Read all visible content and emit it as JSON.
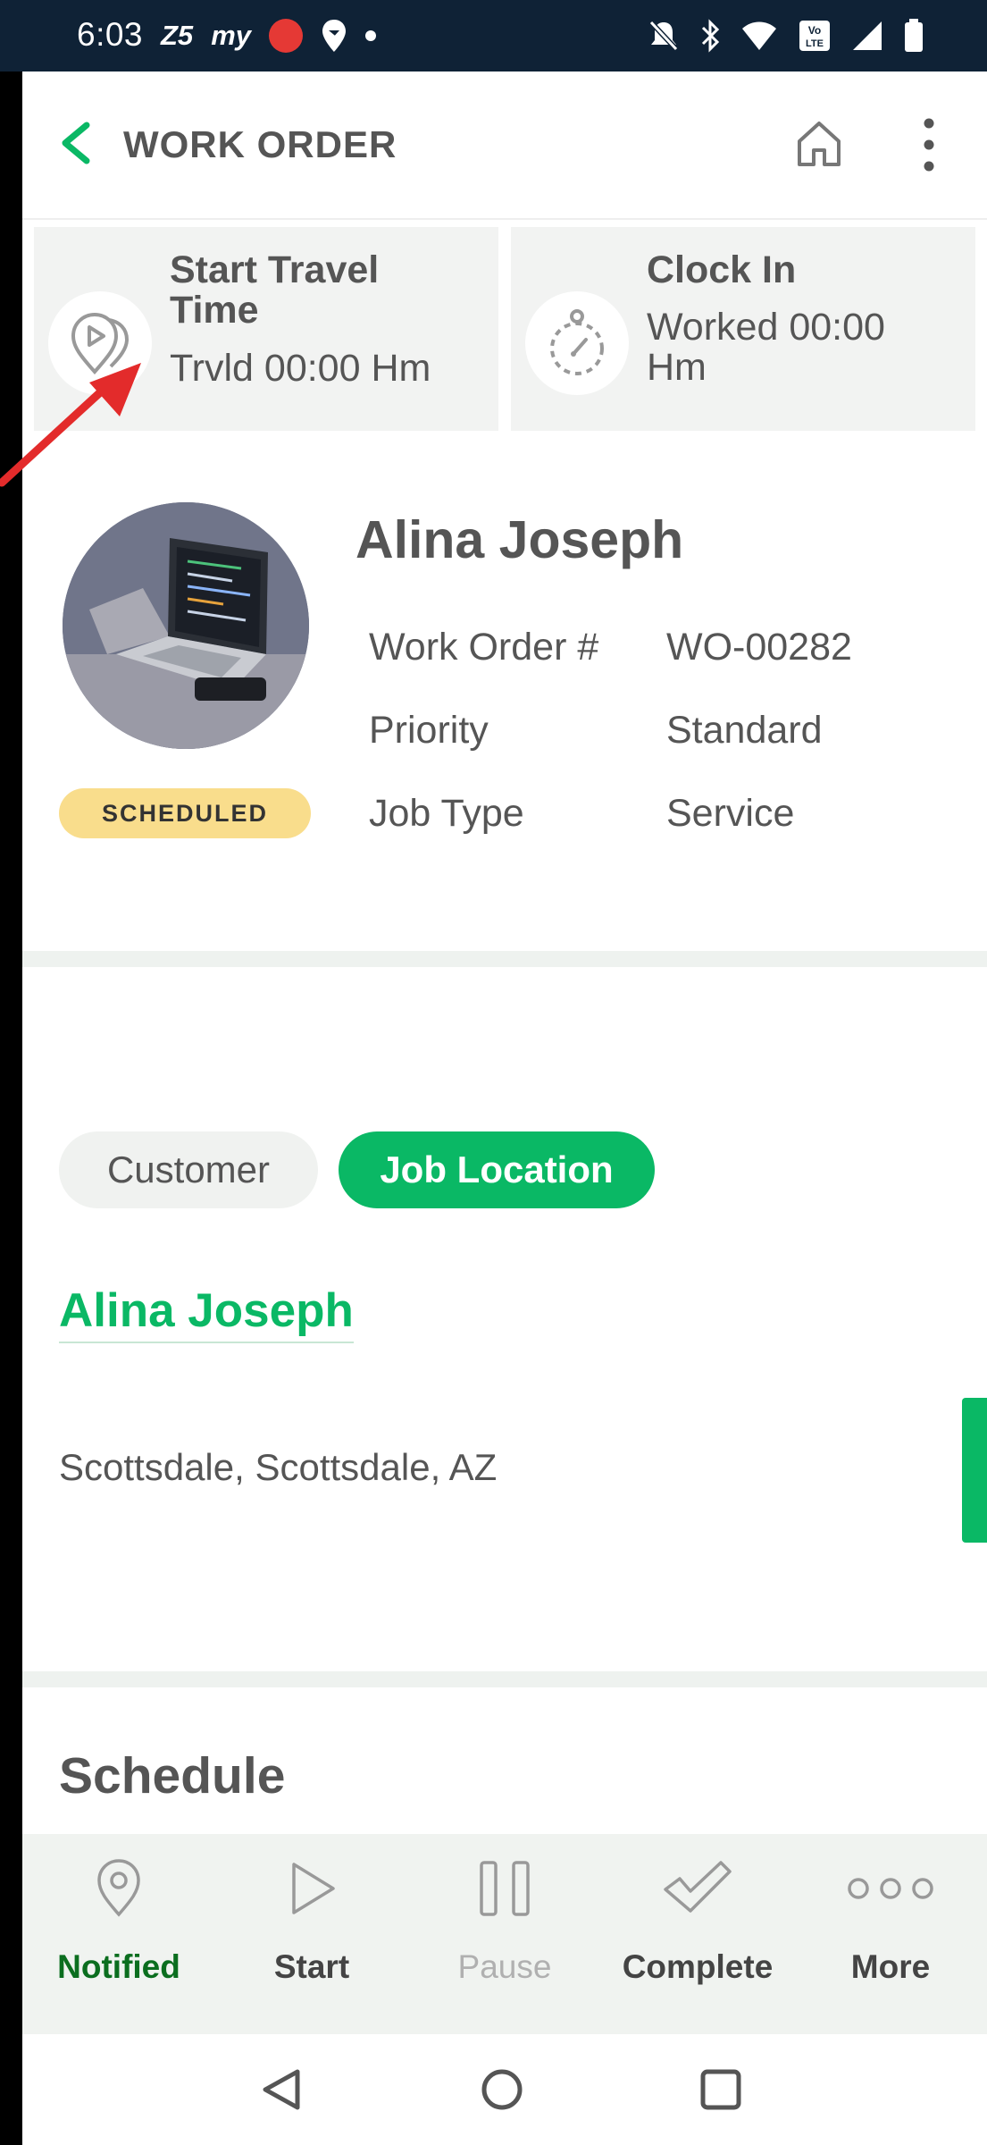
{
  "status_bar": {
    "time": "6:03",
    "app_icons": [
      "Z5",
      "my"
    ]
  },
  "header": {
    "title": "WORK ORDER"
  },
  "tracking": {
    "travel": {
      "title": "Start Travel Time",
      "value": "Trvld 00:00 Hm"
    },
    "clock": {
      "title": "Clock In",
      "value": "Worked 00:00 Hm"
    }
  },
  "work_order": {
    "customer_name": "Alina Joseph",
    "status": "SCHEDULED",
    "details": [
      {
        "label": "Work Order #",
        "value": "WO-00282"
      },
      {
        "label": "Priority",
        "value": "Standard"
      },
      {
        "label": "Job Type",
        "value": "Service"
      }
    ]
  },
  "address_section": {
    "tabs": [
      {
        "label": "Customer",
        "selected": false
      },
      {
        "label": "Job Location",
        "selected": true
      }
    ],
    "contact_name": "Alina Joseph",
    "address": "Scottsdale, Scottsdale, AZ"
  },
  "schedule": {
    "heading": "Schedule"
  },
  "actions": [
    {
      "label": "Notified",
      "icon": "location-pin-icon",
      "state": "active"
    },
    {
      "label": "Start",
      "icon": "play-icon",
      "state": "normal"
    },
    {
      "label": "Pause",
      "icon": "pause-icon",
      "state": "disabled"
    },
    {
      "label": "Complete",
      "icon": "checkmark-icon",
      "state": "normal"
    },
    {
      "label": "More",
      "icon": "more-dots-icon",
      "state": "normal"
    }
  ],
  "colors": {
    "accent": "#0ab865",
    "status_bar": "#0f2236",
    "status_pill": "#f9dd8c",
    "active_action": "#0b6e1f"
  }
}
